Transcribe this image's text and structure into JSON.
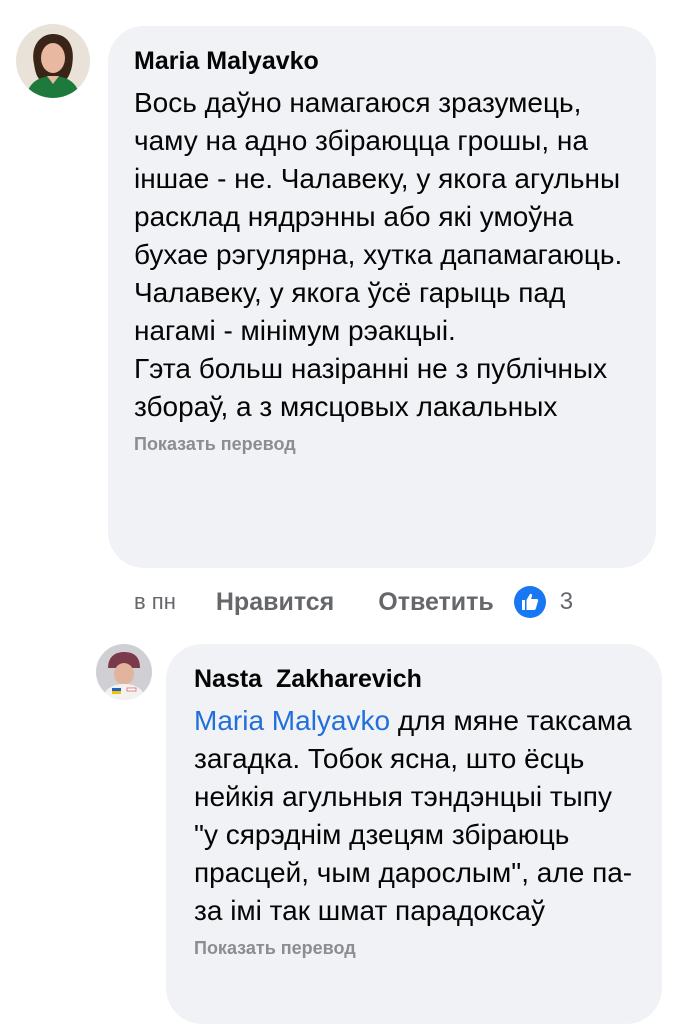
{
  "comment1": {
    "author": "Maria Malyavko",
    "paragraphs": [
      "Вось даўно намагаюся зразумець, чаму на адно збіраюцца грошы, на іншае - не. Чалавеку, у якога агульны расклад нядрэнны або які умоўна бухае рэгулярна, хутка дапамагаюць. Чалавеку, у якога ўсё гарыць пад нагамі - мінімум рэакцыі.",
      "Гэта больш назіранні не з публічных збораў, а з мясцовых лакальных"
    ],
    "translate_label": "Показать перевод",
    "time": "в пн",
    "like_label": "Нравится",
    "reply_label": "Ответить",
    "reaction_icon": "like-icon",
    "reaction_count": "3"
  },
  "comment2": {
    "author": "Nasta  Zakharevich",
    "mention": "Maria Malyavko",
    "text": " для мяне таксама загадка. Тобок ясна, што ёсць нейкія агульныя тэндэнцыі тыпу \"у сярэднім дзецям збіраюць прасцей, чым дарослым\", але па-за імі так шмат парадоксаў",
    "translate_label": "Показать перевод"
  },
  "colors": {
    "bubble_bg": "#f0f2f5",
    "link_blue": "#216fdb",
    "meta_gray": "#65676b",
    "like_blue": "#1877f2"
  }
}
